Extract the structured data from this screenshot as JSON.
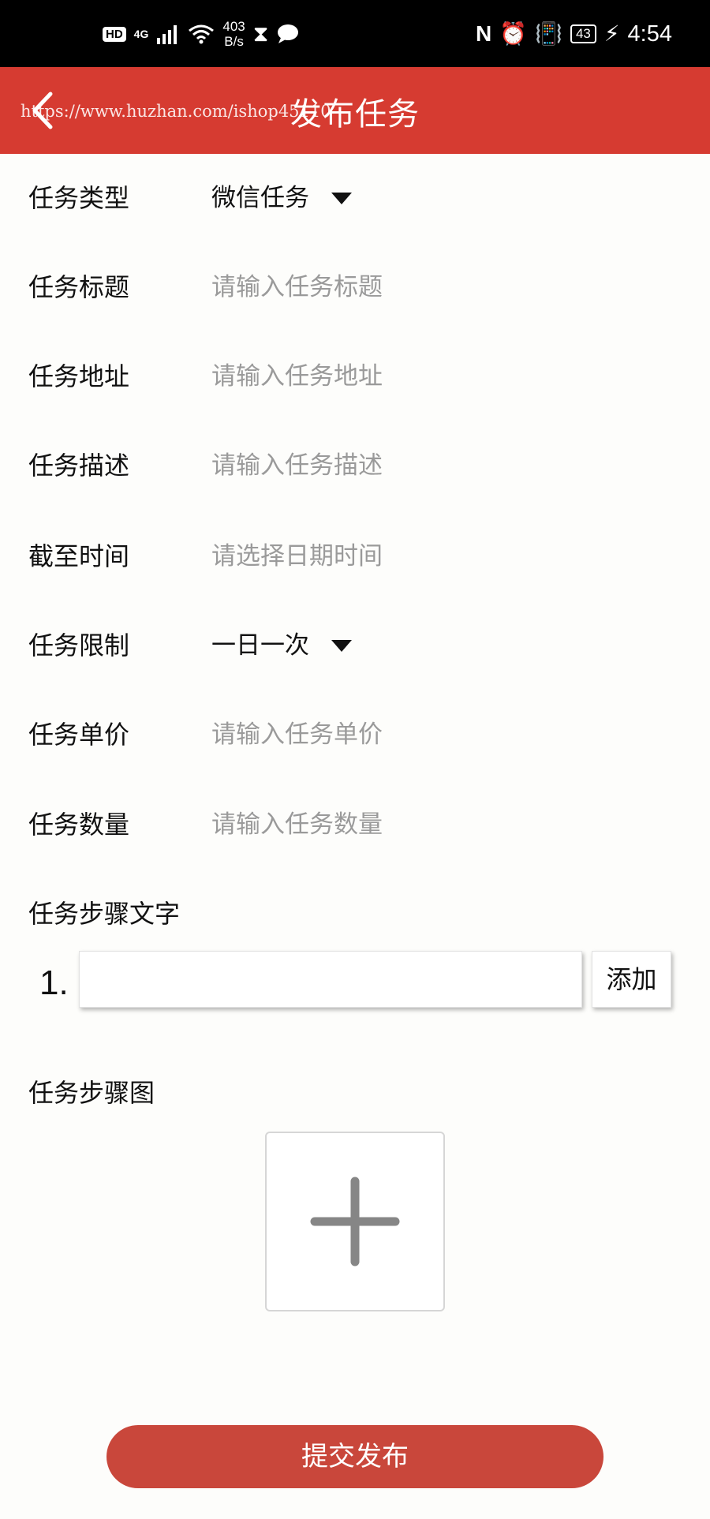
{
  "status_bar": {
    "hd": "HD",
    "network": "4G",
    "speed_value": "403",
    "speed_unit": "B/s",
    "battery": "43",
    "time": "4:54"
  },
  "header": {
    "title": "发布任务",
    "watermark": "https://www.huzhan.com/ishop45110"
  },
  "form": {
    "task_type": {
      "label": "任务类型",
      "value": "微信任务"
    },
    "task_title": {
      "label": "任务标题",
      "placeholder": "请输入任务标题"
    },
    "task_address": {
      "label": "任务地址",
      "placeholder": "请输入任务地址"
    },
    "task_desc": {
      "label": "任务描述",
      "placeholder": "请输入任务描述"
    },
    "deadline": {
      "label": "截至时间",
      "placeholder": "请选择日期时间"
    },
    "task_limit": {
      "label": "任务限制",
      "value": "一日一次"
    },
    "unit_price": {
      "label": "任务单价",
      "placeholder": "请输入任务单价"
    },
    "quantity": {
      "label": "任务数量",
      "placeholder": "请输入任务数量"
    }
  },
  "steps": {
    "text_label": "任务步骤文字",
    "step_number": "1.",
    "step_value": "",
    "add_label": "添加",
    "image_label": "任务步骤图"
  },
  "submit_label": "提交发布",
  "colors": {
    "header_bg": "#d63b31",
    "submit_bg": "#c9473b",
    "placeholder": "#9a9a9a"
  }
}
